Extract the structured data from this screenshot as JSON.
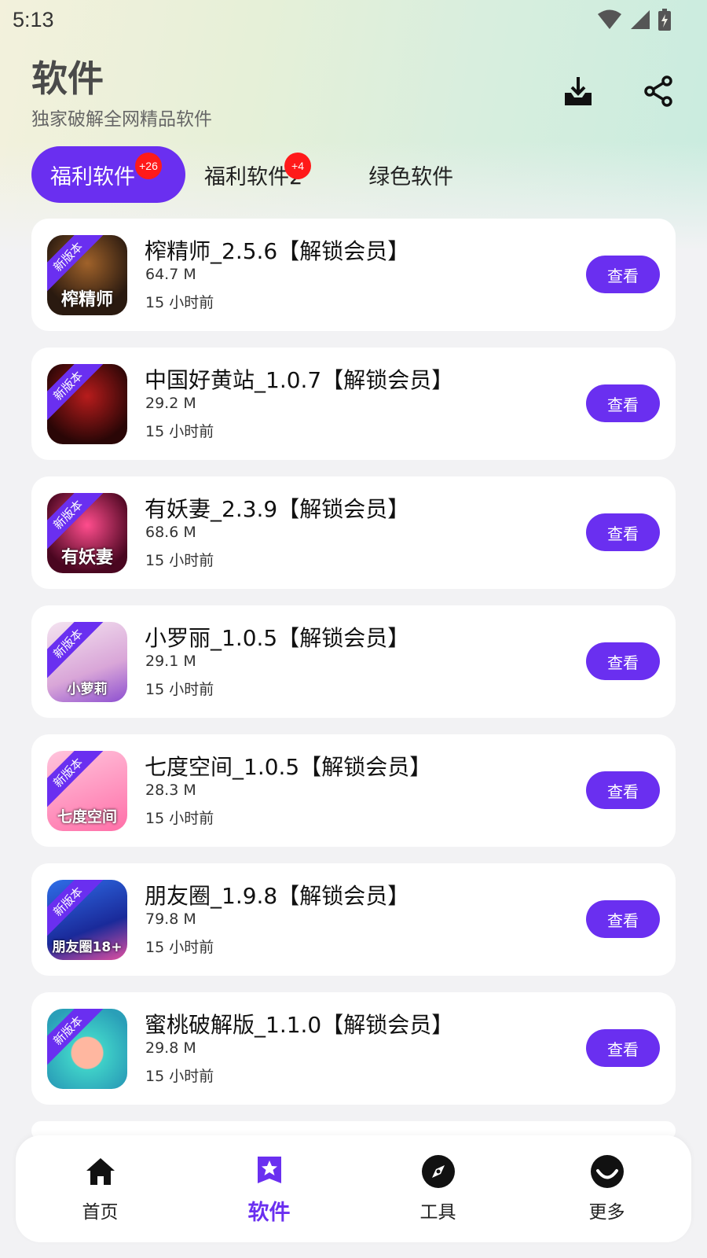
{
  "status_bar": {
    "time": "5:13"
  },
  "header": {
    "title": "软件",
    "subtitle": "独家破解全网精品软件"
  },
  "tabs": [
    {
      "label": "福利软件",
      "badge": "+26",
      "active": true
    },
    {
      "label": "福利软件2",
      "badge": "+4",
      "active": false
    },
    {
      "label": "绿色软件",
      "badge": "",
      "active": false
    }
  ],
  "apps": [
    {
      "name": "榨精师_2.5.6【解锁会员】",
      "size": "64.7 M",
      "time": "15 小时前",
      "ribbon": "新版本",
      "icon_text": "榨精师",
      "action": "查看"
    },
    {
      "name": "中国好黄站_1.0.7【解锁会员】",
      "size": "29.2 M",
      "time": "15 小时前",
      "ribbon": "新版本",
      "icon_text": "",
      "action": "查看"
    },
    {
      "name": "有妖妻_2.3.9【解锁会员】",
      "size": "68.6 M",
      "time": "15 小时前",
      "ribbon": "新版本",
      "icon_text": "有妖妻",
      "action": "查看"
    },
    {
      "name": "小罗丽_1.0.5【解锁会员】",
      "size": "29.1 M",
      "time": "15 小时前",
      "ribbon": "新版本",
      "icon_text": "小萝莉",
      "action": "查看"
    },
    {
      "name": "七度空间_1.0.5【解锁会员】",
      "size": "28.3 M",
      "time": "15 小时前",
      "ribbon": "新版本",
      "icon_text": "七度空间",
      "action": "查看"
    },
    {
      "name": "朋友圈_1.9.8【解锁会员】",
      "size": "79.8 M",
      "time": "15 小时前",
      "ribbon": "新版本",
      "icon_text": "朋友圈18+",
      "action": "查看"
    },
    {
      "name": "蜜桃破解版_1.1.0【解锁会员】",
      "size": "29.8 M",
      "time": "15 小时前",
      "ribbon": "新版本",
      "icon_text": "",
      "action": "查看"
    }
  ],
  "bottom_nav": [
    {
      "label": "首页",
      "icon": "home-icon",
      "active": false
    },
    {
      "label": "软件",
      "icon": "software-star-icon",
      "active": true
    },
    {
      "label": "工具",
      "icon": "compass-icon",
      "active": false
    },
    {
      "label": "更多",
      "icon": "more-smile-icon",
      "active": false
    }
  ],
  "colors": {
    "accent": "#6a2ff0",
    "badge": "#ff1a1a",
    "background": "#f2f2f4"
  }
}
